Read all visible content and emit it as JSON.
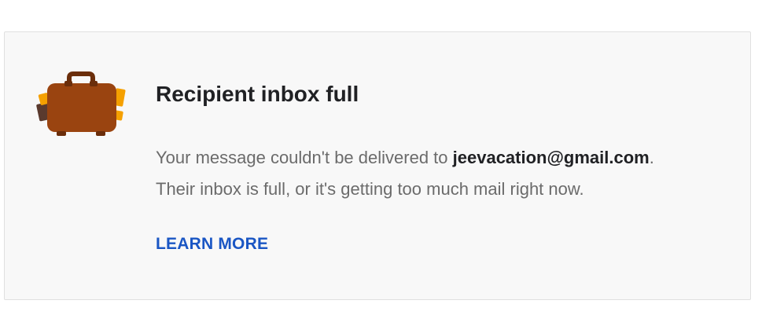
{
  "notice": {
    "title": "Recipient inbox full",
    "message_prefix": "Your message couldn't be delivered to ",
    "recipient_email": "jeevacation@gmail.com",
    "message_suffix_1": ".",
    "message_line_2": "Their inbox is full, or it's getting too much mail right now.",
    "learn_more_label": "LEARN MORE",
    "icon": "suitcase-icon"
  },
  "colors": {
    "suitcase_body": "#9a4410",
    "suitcase_handle": "#6b2e0b",
    "suitcase_accent": "#f5a000",
    "link": "#1a56c4"
  }
}
